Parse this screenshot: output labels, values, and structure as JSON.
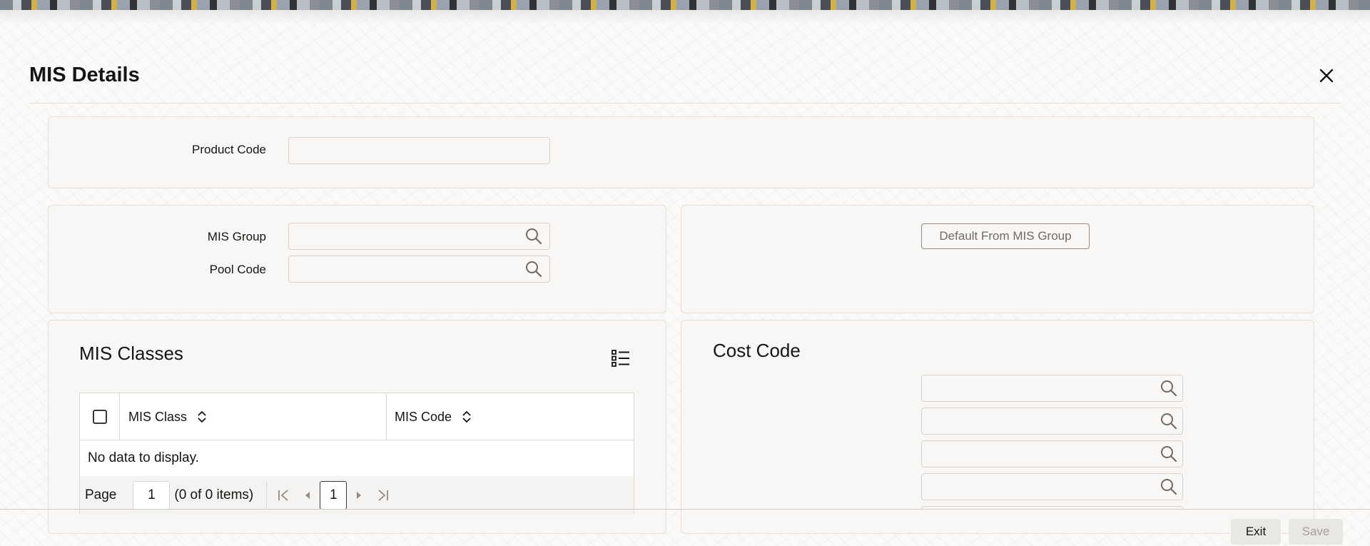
{
  "window": {
    "title": "MIS Details"
  },
  "product": {
    "label": "Product Code",
    "value": ""
  },
  "mis": {
    "group_label": "MIS Group",
    "group_value": "",
    "pool_label": "Pool Code",
    "pool_value": "",
    "default_button": "Default From MIS Group"
  },
  "mis_classes": {
    "title": "MIS Classes",
    "columns": [
      "MIS Class",
      "MIS Code"
    ],
    "rows": [],
    "empty_text": "No data to display.",
    "pager": {
      "page_label": "Page",
      "page_value": "1",
      "summary": "(0 of 0 items)",
      "current_page": "1"
    }
  },
  "cost_code": {
    "title": "Cost Code",
    "fields": [
      "",
      "",
      "",
      ""
    ]
  },
  "footer": {
    "exit_label": "Exit",
    "save_label": "Save"
  },
  "icons": {
    "close": "close-icon",
    "search": "search-icon",
    "column_settings": "list-settings-icon",
    "sort": "sort-icon",
    "first_page": "first-page-icon",
    "prev_page": "prev-page-icon",
    "next_page": "next-page-icon",
    "last_page": "last-page-icon"
  }
}
